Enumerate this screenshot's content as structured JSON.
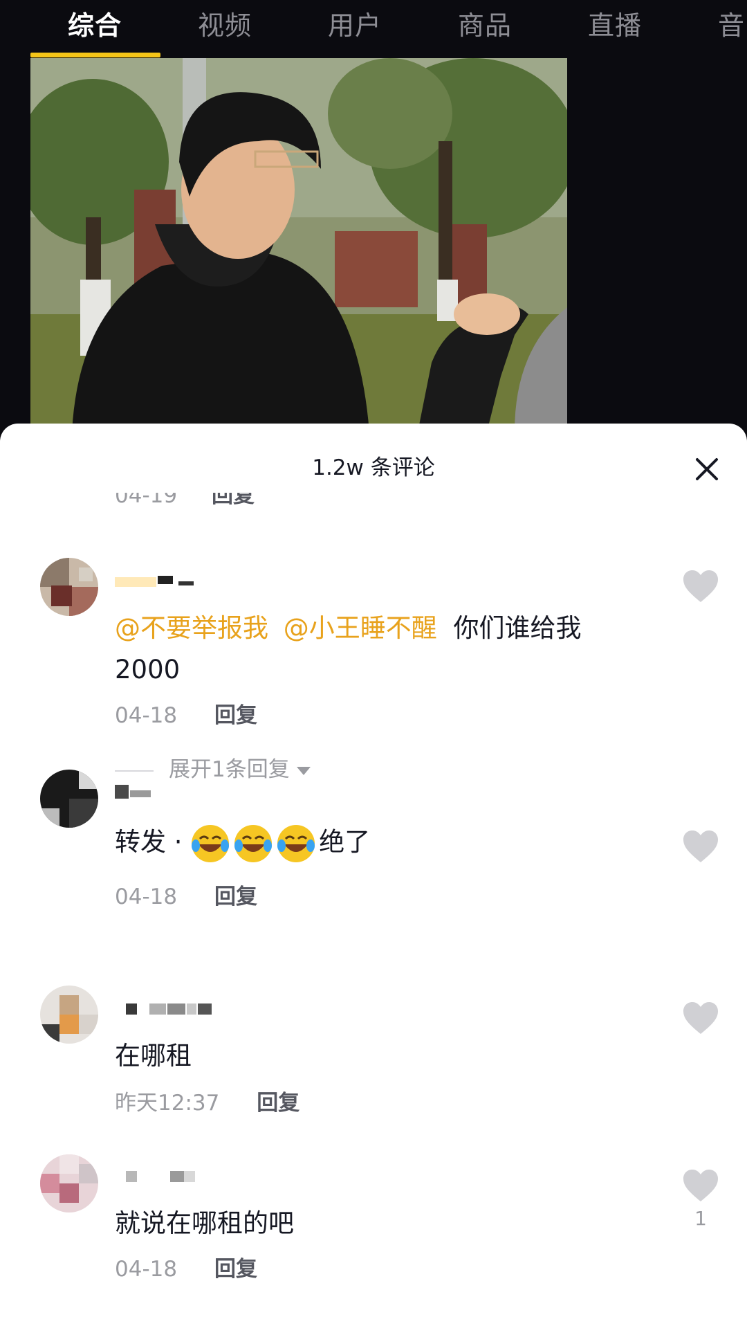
{
  "tabs": [
    "综合",
    "视频",
    "用户",
    "商品",
    "直播",
    "音"
  ],
  "active_tab_index": 0,
  "colors": {
    "accent": "#f5c518",
    "mention": "#e8a21c",
    "text": "#161823",
    "meta": "#9a9ba0"
  },
  "sheet": {
    "title": "1.2w 条评论",
    "close_icon": "close-icon",
    "clipped_row": {
      "time": "04-19",
      "reply": "回复"
    }
  },
  "comments": [
    {
      "mentions": [
        "@不要举报我",
        "@小王睡不醒"
      ],
      "text_line1": "你们谁给我",
      "text_line2": "2000",
      "time": "04-18",
      "reply": "回复",
      "expand": "展开1条回复"
    },
    {
      "text_prefix": "转发 · ",
      "emojis": [
        "tears-of-joy-emoji",
        "tears-of-joy-emoji",
        "tears-of-joy-emoji"
      ],
      "text_suffix": "绝了",
      "time": "04-18",
      "reply": "回复"
    },
    {
      "text": "在哪租",
      "time": "昨天12:37",
      "reply": "回复"
    },
    {
      "text": "就说在哪租的吧",
      "time": "04-18",
      "reply": "回复",
      "likes": "1"
    }
  ]
}
